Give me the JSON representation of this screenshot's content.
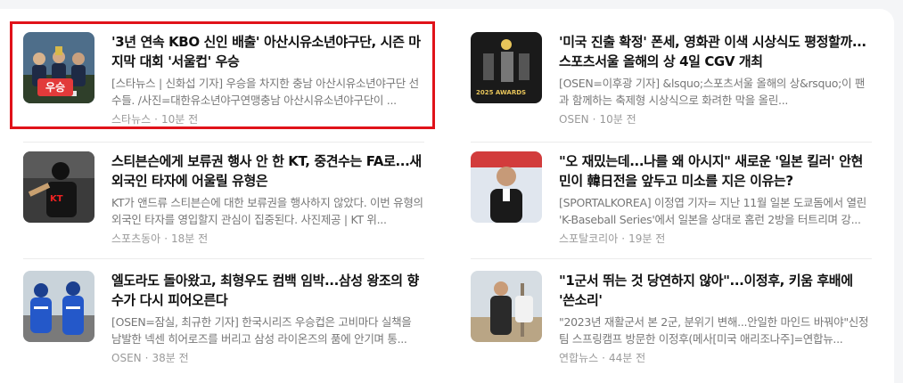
{
  "articles": [
    {
      "title": "'3년 연속 KBO 신인 배출' 아산시유소년야구단, 시즌 마지막 대회 '서울컵' 우승",
      "desc": "[스타뉴스 | 신화섭 기자] 우승을 차지한 충남 아산시유소년야구단 선수들. /사진=대한유소년야구연맹충남 아산시유소년야구단이 ...",
      "source": "스타뉴스",
      "time": "10분 전",
      "badge": "우승",
      "thumb_icon": "trophy-team-photo-icon"
    },
    {
      "title": "'미국 진출 확정' 폰세, 영화관 이색 시상식도 평정할까...스포츠서울 올해의 상 4일 CGV 개최",
      "desc": "[OSEN=이후광 기자] &lsquo;스포츠서울 올해의 상&rsquo;이 팬과 함께하는 축제형 시상식으로 화려한 막을 올린...",
      "source": "OSEN",
      "time": "10분 전",
      "thumb_icon": "awards-poster-icon"
    },
    {
      "title": "스티븐슨에게 보류권 행사 안 한 KT, 중견수는 FA로...새 외국인 타자에 어울릴 유형은",
      "desc": "KT가 앤드류 스티븐슨에 대한 보류권을 행사하지 않았다. 이번 유형의 외국인 타자를 영입할지 관심이 집중된다. 사진제공 | KT 위...",
      "source": "스포츠동아",
      "time": "18분 전",
      "thumb_icon": "kt-batter-icon"
    },
    {
      "title": "\"오 재밌는데...나를 왜 아시지\" 새로운 '일본 킬러' 안현민이 韓日전을 앞두고 미소를 지은 이유는?",
      "desc": "[SPORTALKOREA] 이정엽 기자= 지난 11월 일본 도쿄돔에서 열린 'K-Baseball Series'에서 일본을 상대로 홈런 2방을 터트리며 강...",
      "source": "스포탈코리아",
      "time": "19분 전",
      "thumb_icon": "player-portrait-icon"
    },
    {
      "title": "엘도라도 돌아왔고, 최형우도 컴백 임박...삼성 왕조의 향수가 다시 피어오른다",
      "desc": "[OSEN=잠실, 최규한 기자] 한국시리즈 우승컵은 고비마다 실책을 남발한 넥센 히어로즈를 버리고 삼성 라이온즈의 품에 안기며 통...",
      "source": "OSEN",
      "time": "38분 전",
      "thumb_icon": "samsung-players-icon"
    },
    {
      "title": "\"1군서 뛰는 것 당연하지 않아\"...이정후, 키움 후배에 '쓴소리'",
      "desc": "\"2023년 재활군서 본 2군, 분위기 변해...안일한 마인드 바꿔야\"신정팀 스프링캠프 방문한 이정후(메사[미국 애리조나주]=연합뉴...",
      "source": "연합뉴스",
      "time": "44분 전",
      "thumb_icon": "training-camp-icon"
    }
  ]
}
